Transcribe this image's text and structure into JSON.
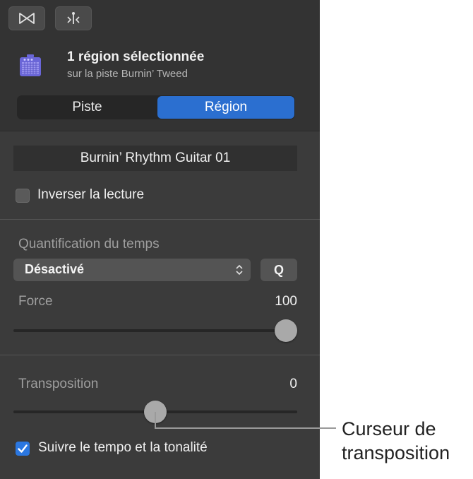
{
  "header": {
    "selection_title": "1 région sélectionnée",
    "selection_subtitle": "sur la piste Burnin’ Tweed",
    "tabs": [
      {
        "label": "Piste",
        "active": false
      },
      {
        "label": "Région",
        "active": true
      }
    ]
  },
  "region": {
    "name": "Burnin’ Rhythm Guitar 01",
    "reverse_label": "Inverser la lecture",
    "reverse_checked": false
  },
  "quantize": {
    "label": "Quantification du temps",
    "value": "Désactivé",
    "q_button": "Q",
    "force_label": "Force",
    "force_value": "100"
  },
  "transpose": {
    "label": "Transposition",
    "value": "0",
    "follow_label": "Suivre le tempo et la tonalité",
    "follow_checked": true
  },
  "callout": {
    "line1": "Curseur de",
    "line2": "transposition"
  },
  "colors": {
    "accent": "#2b6fd0",
    "panel": "#3b3b3b"
  }
}
